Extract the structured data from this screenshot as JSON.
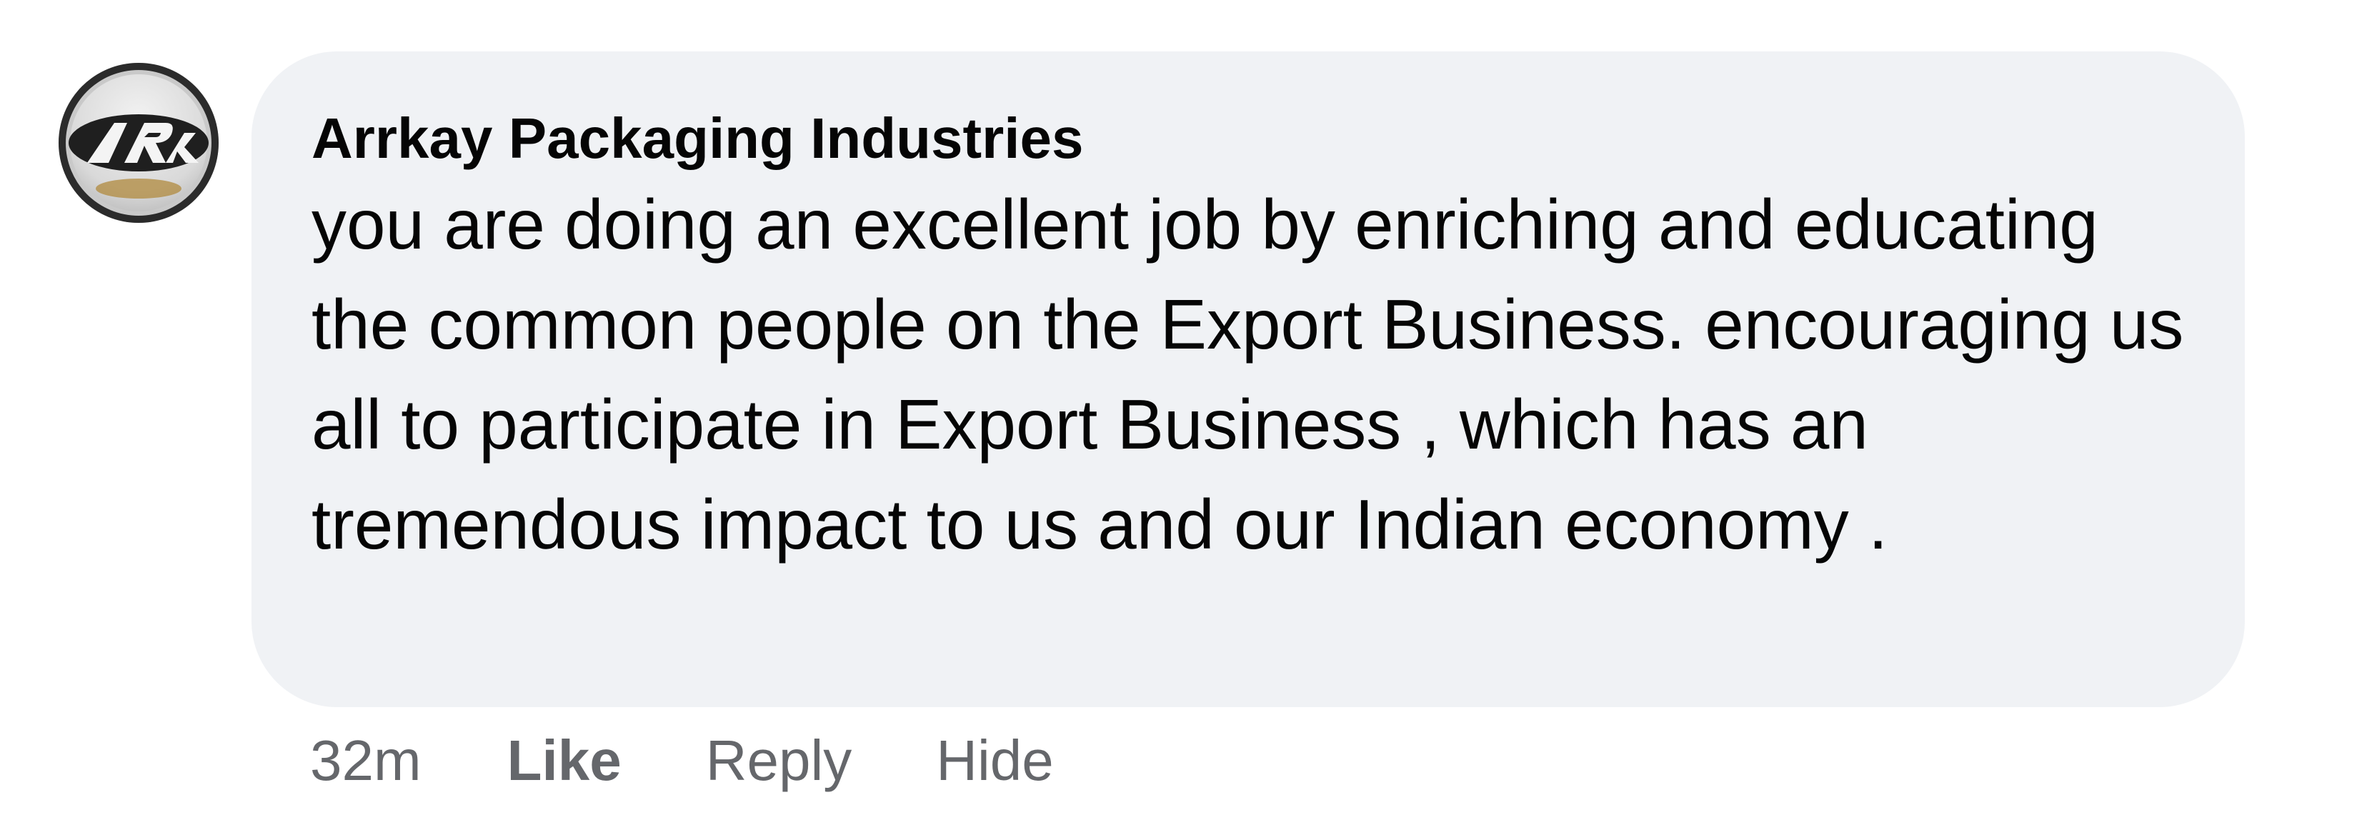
{
  "comment": {
    "author": "Arrkay Packaging Industries",
    "text": "you are doing an excellent job by enriching and educating the common people on the Export Business. encouraging us all to participate in Export Business , which has an tremendous impact to us and our Indian economy .",
    "avatar_icon": "company-logo-icon"
  },
  "actions": {
    "timestamp": "32m",
    "like_label": "Like",
    "reply_label": "Reply",
    "hide_label": "Hide"
  }
}
